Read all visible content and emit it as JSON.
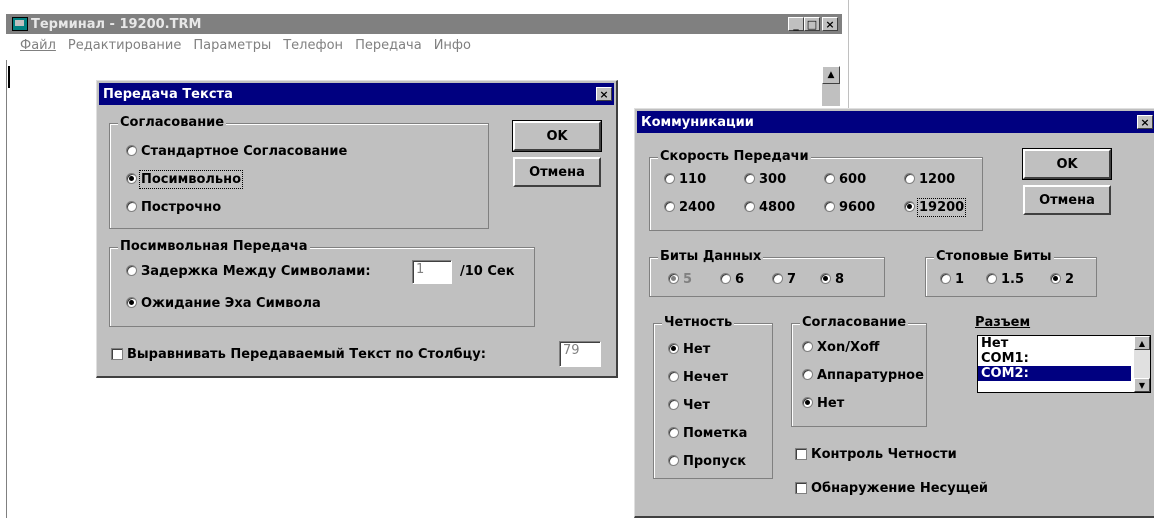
{
  "terminal": {
    "title": "Терминал - 19200.TRM",
    "menu": [
      "Файл",
      "Редактирование",
      "Параметры",
      "Телефон",
      "Передача",
      "Инфо"
    ],
    "win_buttons": [
      "_",
      "□",
      "×"
    ]
  },
  "text_transfer": {
    "title": "Передача Текста",
    "close": "×",
    "ok_label": "OK",
    "cancel_label": "Отмена",
    "flow_group": {
      "title": "Согласование",
      "options": [
        "Стандартное Согласование",
        "Посимвольно",
        "Построчно"
      ],
      "selected": 1
    },
    "char_group": {
      "title": "Посимвольная Передача",
      "delay_label": "Задержка Между Символами:",
      "delay_value": "1",
      "delay_unit": "/10 Сек",
      "echo_label": "Ожидание Эха Символа",
      "selected": 1
    },
    "wrap_label": "Выравнивать Передаваемый Текст по Столбцу:",
    "wrap_value": "79"
  },
  "comm": {
    "title": "Коммуникации",
    "close": "×",
    "ok_label": "OK",
    "cancel_label": "Отмена",
    "baud": {
      "title": "Скорость Передачи",
      "options": [
        "110",
        "300",
        "600",
        "1200",
        "2400",
        "4800",
        "9600",
        "19200"
      ],
      "selected": "19200"
    },
    "data_bits": {
      "title": "Биты Данных",
      "options": [
        "5",
        "6",
        "7",
        "8"
      ],
      "selected": "8"
    },
    "stop_bits": {
      "title": "Стоповые Биты",
      "options": [
        "1",
        "1.5",
        "2"
      ],
      "selected": "2"
    },
    "parity": {
      "title": "Четность",
      "options": [
        "Нет",
        "Нечет",
        "Чет",
        "Пометка",
        "Пропуск"
      ],
      "selected": "Нет"
    },
    "flow": {
      "title": "Согласование",
      "options": [
        "Xon/Xoff",
        "Аппаратурное",
        "Нет"
      ],
      "selected": "Нет"
    },
    "port": {
      "title": "Разъем",
      "items": [
        "Нет",
        "COM1:",
        "COM2:"
      ],
      "selected": "COM2:"
    },
    "parity_check_label": "Контроль Четности",
    "carrier_detect_label": "Обнаружение Несущей"
  }
}
